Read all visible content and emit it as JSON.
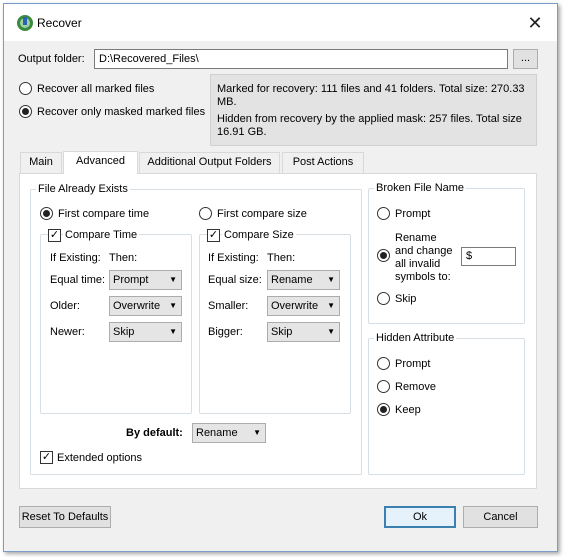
{
  "window": {
    "title": "Recover",
    "close_glyph": "✕",
    "app_icon": "recover-app-icon"
  },
  "output": {
    "label": "Output folder:",
    "path": "D:\\Recovered_Files\\",
    "browse_label": "..."
  },
  "recover_mode": {
    "all_label": "Recover all marked files",
    "masked_label": "Recover only masked marked files",
    "selected": "masked"
  },
  "info": {
    "marked": "Marked for recovery: 111 files and 41 folders. Total size: 270.33 MB.",
    "hidden": "Hidden from recovery by the applied mask: 257 files. Total size 16.91 GB."
  },
  "tabs": [
    {
      "label": "Main"
    },
    {
      "label": "Advanced"
    },
    {
      "label": "Additional Output Folders"
    },
    {
      "label": "Post Actions"
    }
  ],
  "file_exists": {
    "title": "File Already Exists",
    "time": {
      "radio_label": "First compare time",
      "check_label": "Compare Time",
      "if_label": "If Existing:",
      "then_label": "Then:",
      "rows": [
        {
          "label": "Equal time:",
          "value": "Prompt"
        },
        {
          "label": "Older:",
          "value": "Overwrite"
        },
        {
          "label": "Newer:",
          "value": "Skip"
        }
      ]
    },
    "size": {
      "radio_label": "First compare size",
      "check_label": "Compare Size",
      "if_label": "If Existing:",
      "then_label": "Then:",
      "rows": [
        {
          "label": "Equal size:",
          "value": "Rename"
        },
        {
          "label": "Smaller:",
          "value": "Overwrite"
        },
        {
          "label": "Bigger:",
          "value": "Skip"
        }
      ]
    },
    "default_label": "By default:",
    "default_value": "Rename",
    "extended_label": "Extended options",
    "check_glyph": "✓",
    "arrow_glyph": "▼"
  },
  "broken": {
    "title": "Broken File Name",
    "prompt": "Prompt",
    "rename_line1": "Rename",
    "rename_line2": "and change",
    "rename_line3": "all invalid",
    "rename_line4": "symbols to:",
    "symbol_value": "$",
    "skip": "Skip"
  },
  "hidden_attr": {
    "title": "Hidden Attribute",
    "prompt": "Prompt",
    "remove": "Remove",
    "keep": "Keep"
  },
  "buttons": {
    "reset": "Reset To Defaults",
    "ok": "Ok",
    "cancel": "Cancel"
  }
}
